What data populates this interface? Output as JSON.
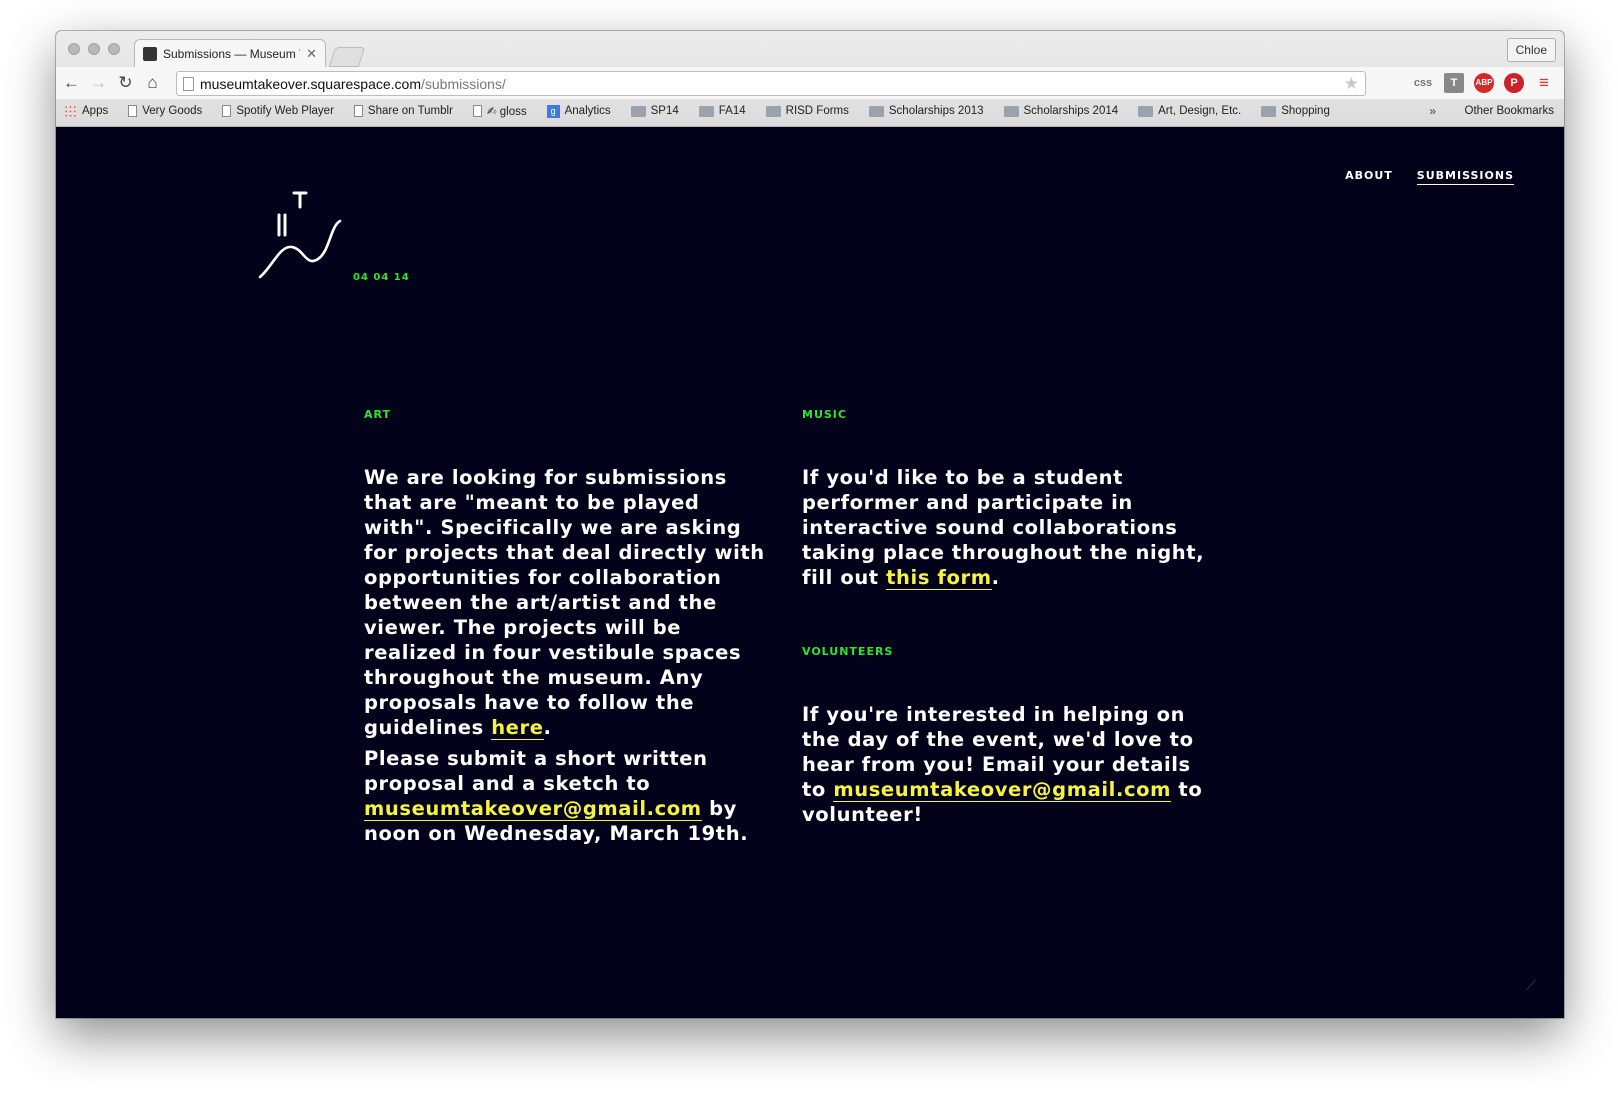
{
  "browser": {
    "tab_title": "Submissions — Museum T",
    "profile_name": "Chloe",
    "url_host": "museumtakeover.squarespace.com",
    "url_path": "/submissions/",
    "extensions": {
      "css": "css",
      "t": "T",
      "abp": "ABP",
      "pin": "P",
      "menu": "≡"
    },
    "bookmarks": [
      {
        "label": "Apps",
        "icon": "apps-icon"
      },
      {
        "label": "Very Goods",
        "icon": "page-icon"
      },
      {
        "label": "Spotify Web Player",
        "icon": "page-icon"
      },
      {
        "label": "Share on Tumblr",
        "icon": "page-icon"
      },
      {
        "label": "✍ gloss",
        "icon": "page-icon"
      },
      {
        "label": "Analytics",
        "icon": "google-icon"
      },
      {
        "label": "SP14",
        "icon": "folder-icon"
      },
      {
        "label": "FA14",
        "icon": "folder-icon"
      },
      {
        "label": "RISD Forms",
        "icon": "folder-icon"
      },
      {
        "label": "Scholarships 2013",
        "icon": "folder-icon"
      },
      {
        "label": "Scholarships 2014",
        "icon": "folder-icon"
      },
      {
        "label": "Art, Design, Etc.",
        "icon": "folder-icon"
      },
      {
        "label": "Shopping",
        "icon": "folder-icon"
      }
    ],
    "bookmarks_more": "»",
    "other_bookmarks": "Other Bookmarks"
  },
  "site": {
    "nav": {
      "about": "ABOUT",
      "submissions": "SUBMISSIONS"
    },
    "date": "04 04 14",
    "colors": {
      "background": "#02031a",
      "accent_green": "#2ee52e",
      "link_yellow": "#f6f244"
    },
    "art": {
      "label": "ART",
      "p1_text": "We are looking for submissions that are \"meant to be played with\". Specifically we are asking for projects that deal directly with opportunities for collaboration between the art/artist and the viewer. The projects will be realized in four vestibule spaces throughout the museum. Any proposals have to follow the guidelines ",
      "p1_link": "here",
      "p1_end": ".",
      "p2_text": "Please submit a short written proposal and a sketch to ",
      "p2_link": "museumtakeover@gmail.com",
      "p2_end": " by noon on Wednesday, March 19th."
    },
    "music": {
      "label": "MUSIC",
      "text": "If you'd like to be a student performer and participate in interactive sound collaborations taking place throughout the night, fill out ",
      "link": "this form",
      "end": "."
    },
    "volunteers": {
      "label": "VOLUNTEERS",
      "text": "If you're interested in helping on the day of the event, we'd love to hear from you! Email your details to ",
      "link": "museumtakeover@gmail.com",
      "end": " to volunteer!"
    }
  }
}
